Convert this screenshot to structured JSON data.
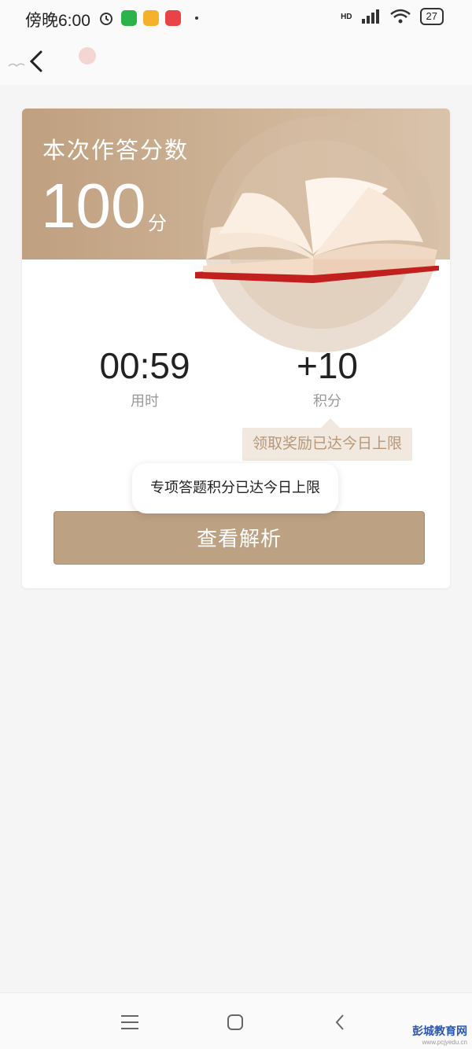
{
  "status_bar": {
    "time": "傍晚6:00",
    "network_label": "HD",
    "battery": "27",
    "app_icons": [
      "alarm-icon",
      "wechat-icon",
      "notes-icon",
      "news-icon"
    ],
    "app_colors": [
      "#2bb44a",
      "#f5b12b",
      "#e94345"
    ]
  },
  "result": {
    "title": "本次作答分数",
    "score": "100",
    "score_unit": "分",
    "time_value": "00:59",
    "time_label": "用时",
    "points_value": "+10",
    "points_label": "积分",
    "reward_tip": "领取奖励已达今日上限",
    "view_analysis_label": "查看解析"
  },
  "toast": {
    "message": "专项答题积分已达今日上限"
  },
  "nav": {
    "buttons": [
      "menu",
      "home",
      "back"
    ]
  },
  "watermark": {
    "name": "彭城教育网",
    "url": "www.pcjyedu.cn"
  },
  "colors": {
    "accent": "#bca183",
    "banner_start": "#bfa080",
    "tip_bg": "#f1e8df",
    "tip_text": "#b69878"
  }
}
